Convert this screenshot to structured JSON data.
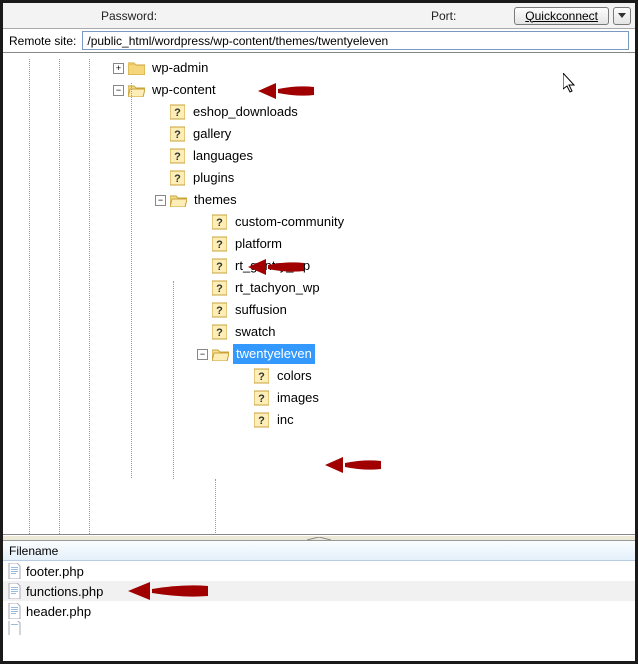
{
  "toolbar": {
    "password_label": "Password:",
    "port_label": "Port:",
    "quickconnect_label": "Quickconnect"
  },
  "remote": {
    "label": "Remote site:",
    "path": "/public_html/wordpress/wp-content/themes/twentyeleven"
  },
  "tree": {
    "wp_admin": "wp-admin",
    "wp_content": "wp-content",
    "eshop": "eshop_downloads",
    "gallery": "gallery",
    "languages": "languages",
    "plugins": "plugins",
    "themes": "themes",
    "custom_community": "custom-community",
    "platform": "platform",
    "rt_gantry": "rt_gantry_wp",
    "rt_tachyon": "rt_tachyon_wp",
    "suffusion": "suffusion",
    "swatch": "swatch",
    "twentyeleven": "twentyeleven",
    "colors": "colors",
    "images": "images",
    "inc": "inc"
  },
  "file_pane": {
    "header": "Filename",
    "footer": "footer.php",
    "functions": "functions.php",
    "headerf": "header.php"
  },
  "glyphs": {
    "plus": "+",
    "minus": "−"
  }
}
